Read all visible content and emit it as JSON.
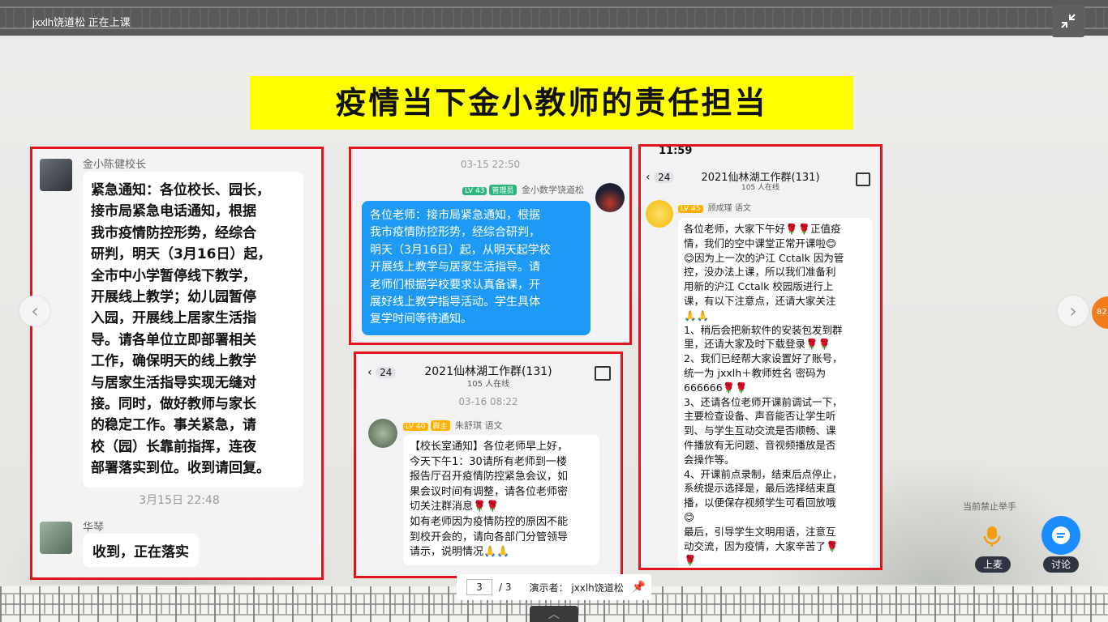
{
  "window": {
    "title": "jxxlh饶道松 正在上课"
  },
  "slide": {
    "headline": "疫情当下金小教师的责任担当",
    "panel1": {
      "sender1": "金小陈健校长",
      "message1": "紧急通知：各位校长、园长，\n接市局紧急电话通知，根据\n我市疫情防控形势，经综合\n研判，明天（3月16日）起，\n全市中小学暂停线下教学，\n开展线上教学；幼儿园暂停\n入园，开展线上居家生活指\n导。请各单位立即部署相关\n工作，确保明天的线上教学\n与居家生活指导实现无缝对\n接。同时，做好教师与家长\n的稳定工作。事关紧急，请\n校（园）长靠前指挥，连夜\n部署落实到位。收到请回复。",
      "timestamp": "3月15日 22:48",
      "sender2": "华琴",
      "message2": "收到，正在落实"
    },
    "panel2": {
      "timestamp": "03-15 22:50",
      "level": "LV 43",
      "role": "管理员",
      "sender": "金小数学饶道松",
      "message": "各位老师：接市局紧急通知，根据\n我市疫情防控形势，经综合研判，\n明天（3月16日）起，从明天起学校\n开展线上教学与居家生活指导。请\n老师们根据学校要求认真备课，开\n展好线上教学指导活动。学生具体\n复学时间等待通知。"
    },
    "panel3": {
      "back_count": "24",
      "group_title": "2021仙林湖工作群(131)",
      "online": "105 人在线",
      "timestamp": "03-16 08:22",
      "level": "LV 40",
      "role": "群主",
      "sender": "朱舒琪 语文",
      "message": "【校长室通知】各位老师早上好，\n今天下午1：30请所有老师到一楼\n报告厅召开疫情防控紧急会议，如\n果会议时间有调整，请各位老师密\n切关注群消息🌹🌹\n如有老师因为疫情防控的原因不能\n到校开会的，请向各部门分管领导\n请示，说明情况🙏🙏"
    },
    "panel4": {
      "status_time": "11:59",
      "back_count": "24",
      "group_title": "2021仙林湖工作群(131)",
      "online": "105 人在线",
      "level": "LV 45",
      "sender": "顾成瑾 语文",
      "message": "各位老师，大家下午好🌹🌹正值疫\n情，我们的空中课堂正常开课啦😊\n😊因为上一次的沪江 Cctalk 因为管\n控，没办法上课，所以我们准备利\n用新的沪江 Cctalk 校园版进行上\n课，有以下注意点，还请大家关注\n🙏🙏\n1、稍后会把新软件的安装包发到群\n里，还请大家及时下载登录🌹🌹\n2、我们已经帮大家设置好了账号，\n统一为 jxxlh＋教师姓名 密码为\n666666🌹🌹\n3、还请各位老师开课前调试一下，\n主要检查设备、声音能否让学生听\n到、与学生互动交流是否顺畅、课\n件播放有无问题、音视频播放是否\n会操作等。\n4、开课前点录制，结束后点停止，\n系统提示选择是，最后选择结束直\n播，以便保存视频学生可看回放哦\n😊\n最后，引导学生文明用语，注意互\n动交流，因为疫情，大家辛苦了🌹\n🌹"
    }
  },
  "pager": {
    "current": "3",
    "total": "/ 3",
    "presenter": "演示者： jxxlh饶道松"
  },
  "side": {
    "raise_hand_status": "当前禁止举手",
    "mic_label": "上麦",
    "discuss_label": "讨论",
    "badge": "82"
  },
  "colors": {
    "panel_border": "#e0141e",
    "headline_bg": "#ffff00",
    "bubble_blue": "#1e9af5",
    "discuss_blue": "#1a8cff"
  }
}
